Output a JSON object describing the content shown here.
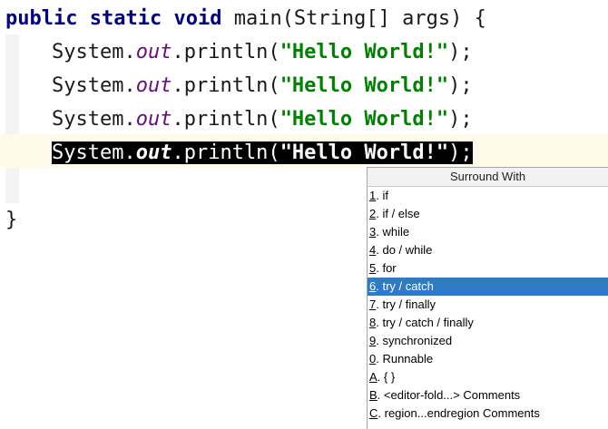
{
  "editor": {
    "lines": [
      {
        "kw1": "public",
        "kw2": "static",
        "kw3": "void",
        "rest": "main(String[] args) {"
      },
      {
        "obj": "System.",
        "field": "out",
        "method": ".println(",
        "str": "\"Hello World!\"",
        "end": ");"
      },
      {
        "obj": "System.",
        "field": "out",
        "method": ".println(",
        "str": "\"Hello World!\"",
        "end": ");"
      },
      {
        "obj": "System.",
        "field": "out",
        "method": ".println(",
        "str": "\"Hello World!\"",
        "end": ");"
      },
      {
        "obj": "System.",
        "field": "out",
        "method": ".println(",
        "str": "\"Hello World!\"",
        "end": ");"
      },
      {
        "brace": "}"
      }
    ]
  },
  "popup": {
    "title": "Surround With",
    "items": [
      {
        "key": "1",
        "label": ". if"
      },
      {
        "key": "2",
        "label": ". if / else"
      },
      {
        "key": "3",
        "label": ". while"
      },
      {
        "key": "4",
        "label": ". do / while"
      },
      {
        "key": "5",
        "label": ". for"
      },
      {
        "key": "6",
        "label": ". try / catch"
      },
      {
        "key": "7",
        "label": ". try / finally"
      },
      {
        "key": "8",
        "label": ". try / catch / finally"
      },
      {
        "key": "9",
        "label": ". synchronized"
      },
      {
        "key": "0",
        "label": ". Runnable"
      },
      {
        "key": "A",
        "label": ". { }"
      },
      {
        "key": "B",
        "label": ". <editor-fold...> Comments"
      },
      {
        "key": "C",
        "label": ". region...endregion Comments"
      }
    ],
    "selected_index": 5
  },
  "colors": {
    "keyword": "#000080",
    "field": "#660e7a",
    "string": "#008000",
    "selection": "#2d7ac7"
  }
}
